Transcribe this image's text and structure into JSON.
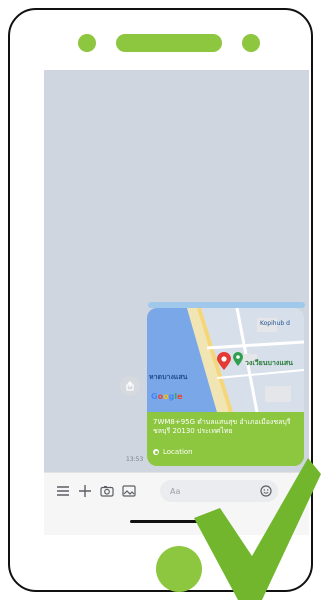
{
  "colors": {
    "accent_green": "#8dc63f",
    "screen_bg": "#cfd6e0",
    "input_bg": "#ebecef",
    "frame": "#111111"
  },
  "map": {
    "place_label": "หาดบางแสน",
    "poi_label": "วงเวียนบางแสน",
    "top_right_label": "Kopihub d",
    "google_logo": "Google"
  },
  "message": {
    "address": "7WM8+95G ตำบลแสนสุข อำเภอเมืองชลบุรี ชลบุรี 20130 ประเทศไทย",
    "location_label": "Location",
    "time": "13:53"
  },
  "input": {
    "placeholder": "Aa"
  },
  "icons": {
    "menu": "menu-icon",
    "add": "plus-icon",
    "camera": "camera-icon",
    "gallery": "image-icon",
    "emoji": "emoji-icon",
    "mic": "mic-icon",
    "share": "share-icon",
    "check": "check-icon"
  }
}
